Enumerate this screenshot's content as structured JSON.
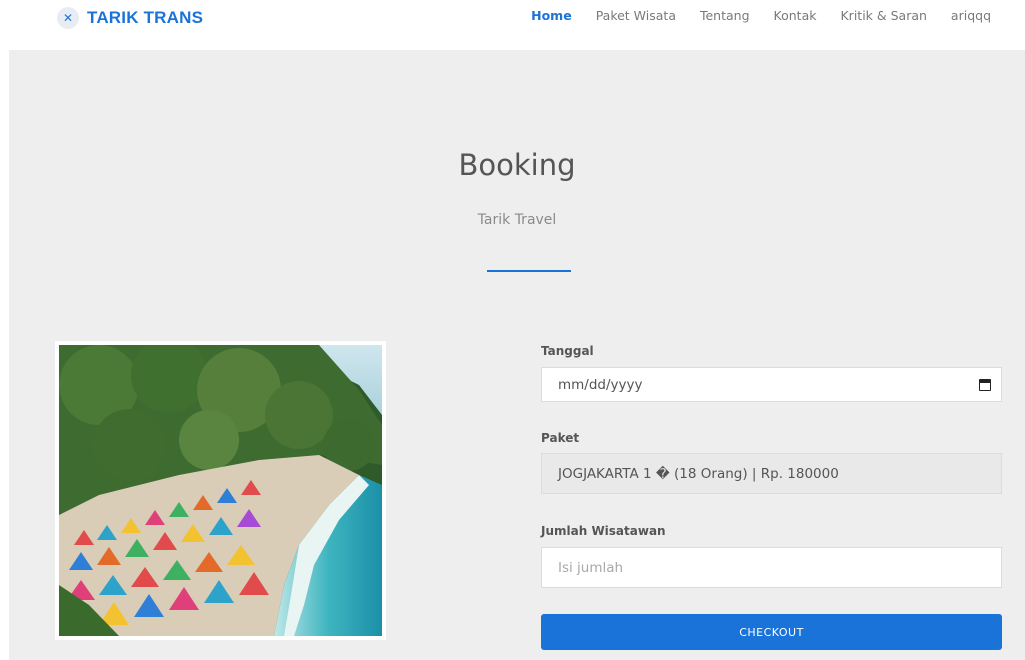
{
  "brand": {
    "name": "TARIK TRANS",
    "icon": "close-icon"
  },
  "nav": [
    {
      "label": "Home",
      "active": true
    },
    {
      "label": "Paket Wisata",
      "active": false
    },
    {
      "label": "Tentang",
      "active": false
    },
    {
      "label": "Kontak",
      "active": false
    },
    {
      "label": "Kritik & Saran",
      "active": false
    },
    {
      "label": "ariqqq",
      "active": false
    }
  ],
  "page": {
    "title": "Booking",
    "subtitle": "Tarik Travel"
  },
  "form": {
    "tanggal": {
      "label": "Tanggal",
      "value": "mm/dd/yyyy",
      "icon": "calendar-icon"
    },
    "paket": {
      "label": "Paket",
      "value": "JOGJAKARTA 1 � (18 Orang) | Rp. 180000"
    },
    "jumlah": {
      "label": "Jumlah Wisatawan",
      "placeholder": "Isi jumlah"
    },
    "checkout_label": "CHECKOUT"
  },
  "colors": {
    "accent": "#1a73d9",
    "background": "#eeeeee"
  }
}
